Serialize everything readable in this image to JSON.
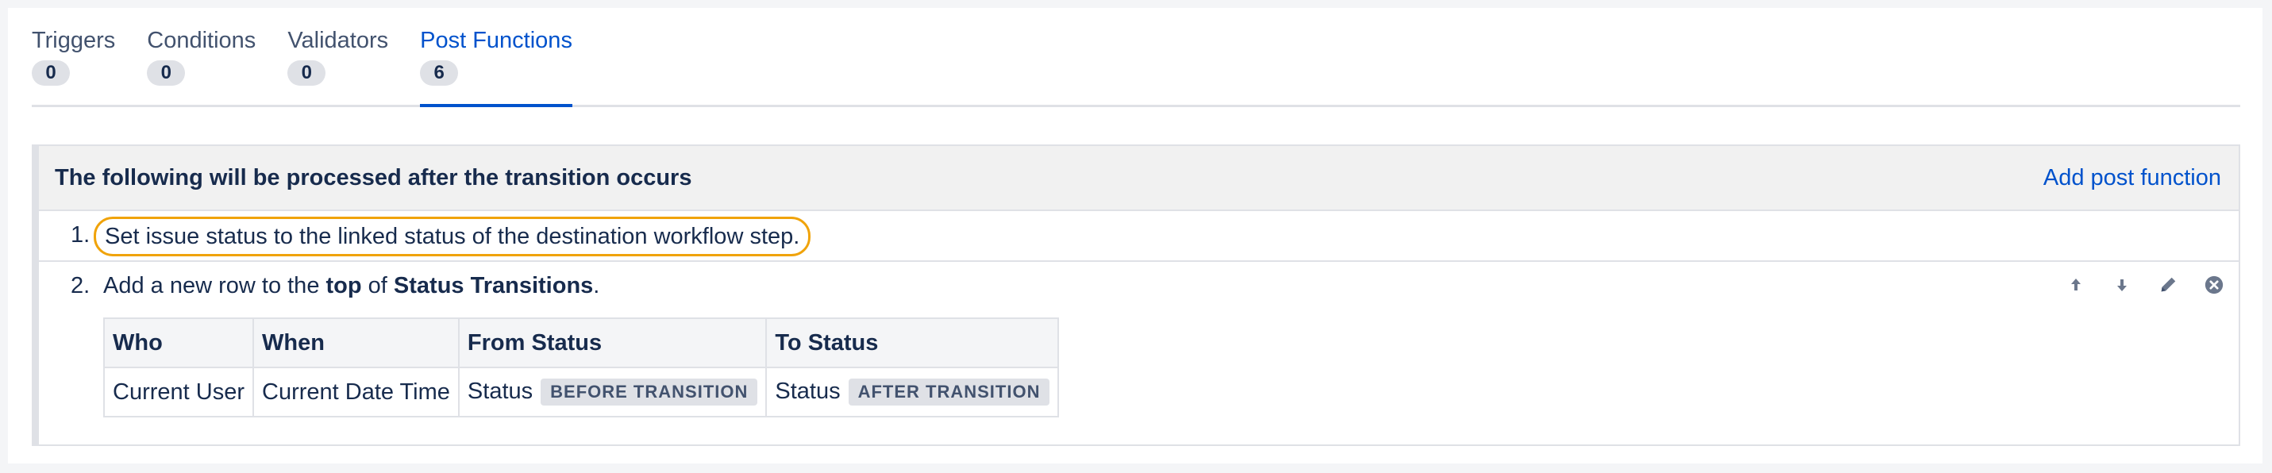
{
  "tabs": [
    {
      "label": "Triggers",
      "count": "0",
      "active": false
    },
    {
      "label": "Conditions",
      "count": "0",
      "active": false
    },
    {
      "label": "Validators",
      "count": "0",
      "active": false
    },
    {
      "label": "Post Functions",
      "count": "6",
      "active": true
    }
  ],
  "panel": {
    "title": "The following will be processed after the transition occurs",
    "add_link": "Add post function"
  },
  "functions": [
    {
      "number": "1.",
      "text": "Set issue status to the linked status of the destination workflow step."
    },
    {
      "number": "2.",
      "text_prefix": "Add a new row to the ",
      "text_bold1": "top",
      "text_mid": " of ",
      "text_bold2": "Status Transitions",
      "text_suffix": ".",
      "actions": [
        "arrow-up-icon",
        "arrow-down-icon",
        "edit-pencil-icon",
        "delete-icon"
      ],
      "table": {
        "headers": [
          "Who",
          "When",
          "From Status",
          "To Status"
        ],
        "row": {
          "who": "Current User",
          "when": "Current Date Time",
          "from_status": "Status",
          "from_lozenge": "BEFORE TRANSITION",
          "to_status": "Status",
          "to_lozenge": "AFTER TRANSITION"
        }
      }
    }
  ],
  "colors": {
    "link": "#0052cc",
    "highlight_ring": "#f0a30a",
    "text": "#172b4d"
  }
}
